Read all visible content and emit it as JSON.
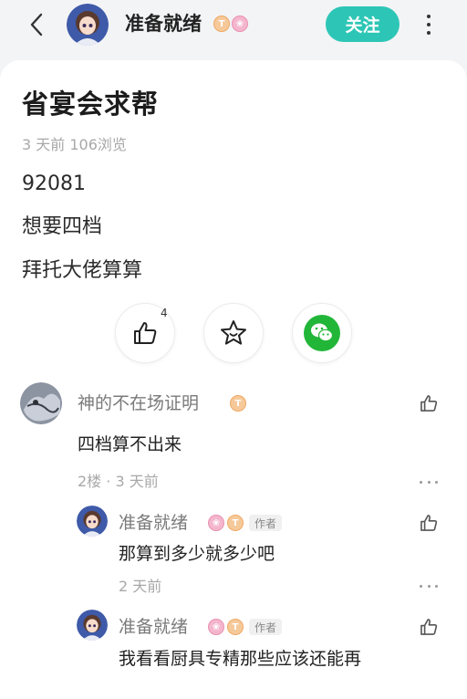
{
  "header": {
    "username": "准备就绪",
    "follow_label": "关注",
    "badge_t": "T",
    "badge_r": "❀"
  },
  "post": {
    "title": "省宴会求帮",
    "meta": "3 天前  106浏览",
    "lines": [
      "92081",
      "想要四档",
      "拜托大佬算算"
    ],
    "like_count": "4"
  },
  "comments": [
    {
      "name": "神的不在场证明",
      "text": "四档算不出来",
      "meta": "2楼 · 3 天前"
    }
  ],
  "replies": [
    {
      "name": "准备就绪",
      "author_tag": "作者",
      "text": "那算到多少就多少吧",
      "meta": "2 天前"
    },
    {
      "name": "准备就绪",
      "author_tag": "作者",
      "text": "我看看厨具专精那些应该还能再"
    }
  ],
  "colors": {
    "accent": "#2dc6b6",
    "wechat": "#22b638"
  }
}
